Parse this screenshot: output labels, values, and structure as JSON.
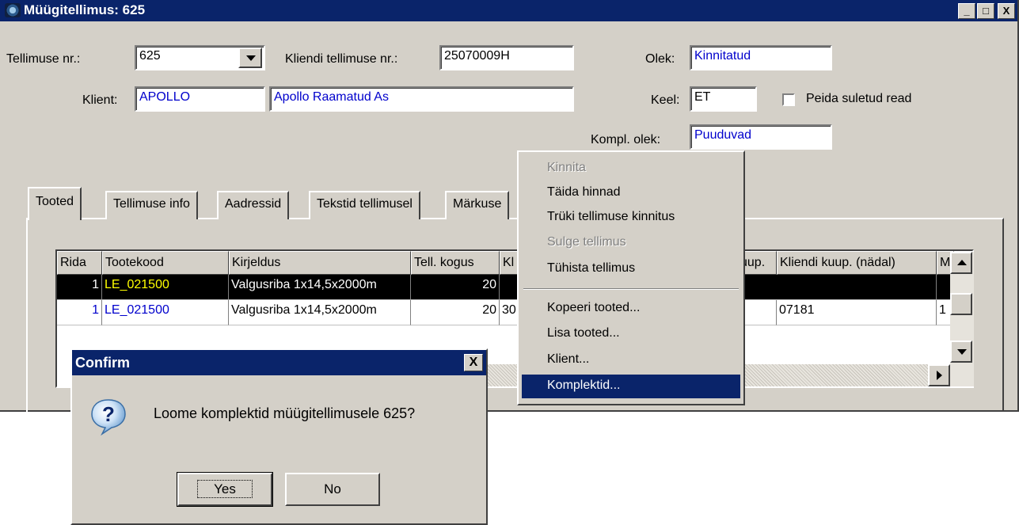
{
  "window": {
    "title": "Müügitellimus: 625",
    "min_label": "_",
    "max_label": "□",
    "close_label": "X"
  },
  "form": {
    "tellimuse_nr_label": "Tellimuse nr.:",
    "tellimuse_nr_value": "625",
    "kliendi_tellimuse_nr_label": "Kliendi tellimuse nr.:",
    "kliendi_tellimuse_nr_value": "25070009H",
    "olek_label": "Olek:",
    "olek_value": "Kinnitatud",
    "klient_label": "Klient:",
    "klient_code": "APOLLO",
    "klient_name": "Apollo Raamatud As",
    "keel_label": "Keel:",
    "keel_value": "ET",
    "peida_label": "Peida suletud read",
    "kompl_olek_label": "Kompl. olek:",
    "kompl_olek_value": "Puuduvad"
  },
  "tabs": [
    "Tooted",
    "Tellimuse info",
    "Aadressid",
    "Tekstid tellimusel",
    "Märkuse"
  ],
  "grid": {
    "headers": [
      "Rida",
      "Tootekood",
      "Kirjeldus",
      "Tell. kogus",
      "Kl",
      "uup.",
      "Kliendi kuup. (nädal)",
      "M"
    ],
    "rows": [
      [
        "1",
        "LE_021500",
        "Valgusriba 1x14,5x2000m",
        "20",
        "",
        "",
        "",
        ""
      ],
      [
        "1",
        "LE_021500",
        "Valgusriba 1x14,5x2000m",
        "20",
        "30",
        "",
        "07181",
        "1"
      ]
    ]
  },
  "context_menu": {
    "items": [
      {
        "label": "Kinnita",
        "disabled": true
      },
      {
        "label": "Täida hinnad",
        "disabled": false
      },
      {
        "label": "Trüki tellimuse kinnitus",
        "disabled": false
      },
      {
        "label": "Sulge tellimus",
        "disabled": true
      },
      {
        "label": "Tühista tellimus",
        "disabled": false
      },
      {
        "label": "Kopeeri tooted...",
        "disabled": false
      },
      {
        "label": "Lisa tooted...",
        "disabled": false
      },
      {
        "label": "Klient...",
        "disabled": false
      },
      {
        "label": "Komplektid...",
        "disabled": false,
        "highlighted": true
      }
    ]
  },
  "dialog": {
    "title": "Confirm",
    "close_label": "X",
    "message": "Loome komplektid müügitellimusele 625?",
    "yes_label": "Yes",
    "no_label": "No",
    "icon": "question-icon"
  },
  "colors": {
    "titlebar": "#0a246a",
    "window_bg": "#d4d0c8",
    "field_text_blue": "#0000cc",
    "selected_code": "#ffff00",
    "menu_highlight": "#0a246a"
  }
}
